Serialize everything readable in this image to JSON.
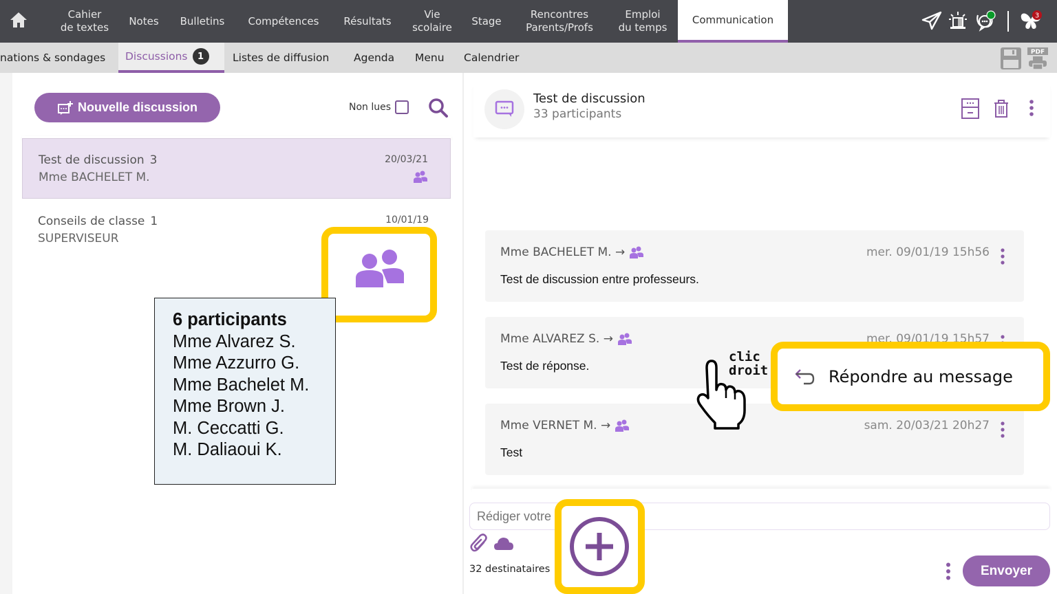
{
  "topnav": {
    "items": [
      {
        "label": "Cahier\nde textes"
      },
      {
        "label": "Notes"
      },
      {
        "label": "Bulletins"
      },
      {
        "label": "Compétences"
      },
      {
        "label": "Résultats"
      },
      {
        "label": "Vie\nscolaire"
      },
      {
        "label": "Stage"
      },
      {
        "label": "Rencontres\nParents/Profs"
      },
      {
        "label": "Emploi\ndu temps"
      },
      {
        "label": "Communication"
      }
    ],
    "active": "Communication",
    "notification_count": "3",
    "icons": [
      "home-icon",
      "send-icon",
      "alert-beacon-icon",
      "chat-status-icon",
      "butterfly-icon"
    ]
  },
  "subnav": {
    "tabs": [
      {
        "label": "nations & sondages"
      },
      {
        "label": "Discussions",
        "badge": "1"
      },
      {
        "label": "Listes de diffusion"
      },
      {
        "label": "Agenda"
      },
      {
        "label": "Menu"
      },
      {
        "label": "Calendrier"
      }
    ],
    "active": "Discussions",
    "pdf_label": "PDF"
  },
  "left": {
    "new_button": "Nouvelle discussion",
    "unread_label": "Non lues",
    "unread_checked": false,
    "conversations": [
      {
        "title": "Test de discussion",
        "count": "3",
        "author": "Mme BACHELET M.",
        "date": "20/03/21",
        "selected": true
      },
      {
        "title": "Conseils de classe",
        "count": "1",
        "author": "SUPERVISEUR",
        "date": "10/01/19",
        "selected": false
      }
    ]
  },
  "tooltip": {
    "header": "6 participants",
    "names": [
      "Mme Alvarez S.",
      "Mme Azzurro G.",
      "Mme Bachelet M.",
      "Mme Brown J.",
      "M. Ceccatti G.",
      "M. Daliaoui K."
    ]
  },
  "chat": {
    "title": "Test de discussion",
    "participants": "33 participants",
    "messages": [
      {
        "from": "Mme BACHELET M. →",
        "date": "mer. 09/01/19 15h56",
        "body": "Test de discussion entre professeurs."
      },
      {
        "from": "Mme ALVAREZ S. →",
        "date": "mer. 09/01/19 15h57",
        "body": "Test de réponse."
      },
      {
        "from": "Mme VERNET M. →",
        "date": "sam. 20/03/21 20h27",
        "body": "Test"
      }
    ],
    "context_menu": {
      "reply": "Répondre au message"
    },
    "hint": {
      "line1": "clic",
      "line2": "droit"
    },
    "compose_placeholder": "Rédiger votre",
    "recipients": "32 destinataires",
    "send_label": "Envoyer"
  },
  "colors": {
    "accent": "#9465ad",
    "topbar": "#46474c",
    "highlight": "#ffcc00",
    "selected_row": "#e9dff0"
  }
}
